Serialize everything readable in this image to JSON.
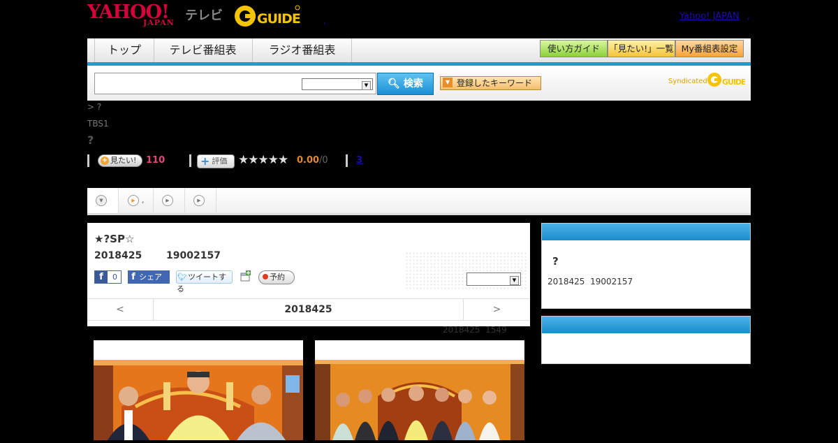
{
  "header": {
    "yahoo_logo": "YAHOO!",
    "japan_logo": "JAPAN",
    "tv_logo": "テレビ",
    "gguide_logo": "G-GUIDE",
    "yahoo_japan_link": "Yahoo! JAPAN",
    "dot_left": ",",
    "dot_right": ","
  },
  "nav": {
    "tabs": [
      "トップ",
      "テレビ番組表",
      "ラジオ番組表"
    ],
    "guide_buttons": [
      "使い方ガイド",
      "「見たい!」一覧",
      "My番組表設定"
    ]
  },
  "search": {
    "input_value": "",
    "select_value": "",
    "button_label": "検索",
    "keyword_button": "登録したキーワード",
    "syndicated": "Syndicated"
  },
  "info": {
    "breadcrumb": "> ?",
    "station": "TBS1",
    "title": "?",
    "mitai_label": "見たい!",
    "mitai_count": "110",
    "hyoka_label": "評価",
    "stars": "★★★★★",
    "score": "0.00",
    "score_den": "/0",
    "link": "3"
  },
  "tabstrip": {
    "second_tab_text": ","
  },
  "program": {
    "title": "★?SP☆",
    "date": "2018425",
    "time": "19002157",
    "fb_like_count": "0",
    "fb_share": "シェア",
    "tweet": "ツイートする",
    "reserve": "予約",
    "select_value": "",
    "pager_prev": "<",
    "pager_date": "2018425",
    "pager_next": ">",
    "update_date": "2018425",
    "update_time": "1549"
  },
  "sidebar": {
    "box1_title": "?",
    "box1_date": "2018425",
    "box1_time": "19002157"
  },
  "colors": {
    "accent_blue": "#1e9bd7",
    "yahoo_red": "#d6003a",
    "mitai_pink": "#e5457a",
    "score_orange": "#e08a2b"
  }
}
